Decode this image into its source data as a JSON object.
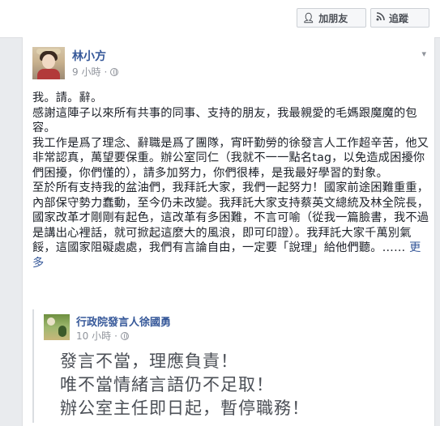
{
  "header": {
    "add_friend_label": "加朋友",
    "follow_label": "追蹤",
    "add_friend_icon": "add-person-icon",
    "follow_icon": "rss-icon"
  },
  "post": {
    "author": "林小方",
    "time": "9 小時",
    "paragraphs": [
      "我。請。辭。",
      "感謝這陣子以來所有共事的同事、支持的朋友，我最親愛的毛媽跟魔魔的包容。",
      "我工作是爲了理念、辭職是爲了團隊，宵旰勤勞的徐發言人工作超辛苦，他又非常認真，萬望要保重。辦公室同仁（我就不一一點名tag，以免造成困擾你們困擾，你們懂的），請多加努力，你們很棒，是我最好學習的對象。",
      "至於所有支持我的盆油們，我拜託大家，我們一起努力！國家前途困難重重，內部保守勢力蠢動，至今仍未改變。我拜託大家支持蔡英文總統及林全院長，國家改革才剛剛有起色，這改革有多困難，不言可喻（從我一篇臉書，我不過是講出心裡話，就可掀起這麼大的風浪，即可印證）。我拜託大家千萬別氣餒，這國家阻礙處處，我們有言論自由，一定要「說理」給他們聽。……"
    ],
    "more_label": "更多"
  },
  "shared": {
    "author": "行政院發言人徐國勇",
    "time": "10 小時",
    "lines": [
      "發言不當，理應負責！",
      "唯不當情緒言語仍不足取！",
      "辦公室主任即日起，暫停職務！"
    ]
  }
}
